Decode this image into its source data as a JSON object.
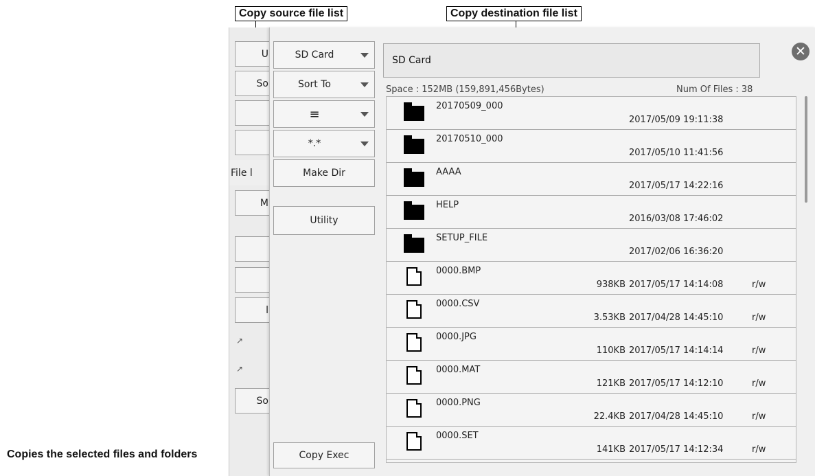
{
  "callouts": {
    "source": "Copy source file list",
    "destination": "Copy destination file list",
    "copy_exec": "Copies the selected files and folders"
  },
  "source_panel": {
    "fragments": [
      "U",
      "So",
      "",
      "",
      "File l",
      "M",
      "",
      "",
      "l",
      "",
      "",
      "So"
    ]
  },
  "sidebar": {
    "drive": "SD Card",
    "sort": "Sort To",
    "view": "≡",
    "filter": "*.*",
    "make_dir": "Make Dir",
    "utility": "Utility",
    "copy_exec": "Copy Exec"
  },
  "path": "SD Card",
  "space_text": "Space : 152MB (159,891,456Bytes)",
  "num_files_text": "Num Of Files : 38",
  "files": [
    {
      "type": "folder",
      "name": "20170509_000",
      "size": "",
      "date": "2017/05/09 19:11:38",
      "attr": ""
    },
    {
      "type": "folder",
      "name": "20170510_000",
      "size": "",
      "date": "2017/05/10 11:41:56",
      "attr": ""
    },
    {
      "type": "folder",
      "name": "AAAA",
      "size": "",
      "date": "2017/05/17 14:22:16",
      "attr": ""
    },
    {
      "type": "folder",
      "name": "HELP",
      "size": "",
      "date": "2016/03/08 17:46:02",
      "attr": ""
    },
    {
      "type": "folder",
      "name": "SETUP_FILE",
      "size": "",
      "date": "2017/02/06 16:36:20",
      "attr": ""
    },
    {
      "type": "file",
      "name": "0000.BMP",
      "size": "938KB",
      "date": "2017/05/17 14:14:08",
      "attr": "r/w"
    },
    {
      "type": "file",
      "name": "0000.CSV",
      "size": "3.53KB",
      "date": "2017/04/28 14:45:10",
      "attr": "r/w"
    },
    {
      "type": "file",
      "name": "0000.JPG",
      "size": "110KB",
      "date": "2017/05/17 14:14:14",
      "attr": "r/w"
    },
    {
      "type": "file",
      "name": "0000.MAT",
      "size": "121KB",
      "date": "2017/05/17 14:12:10",
      "attr": "r/w"
    },
    {
      "type": "file",
      "name": "0000.PNG",
      "size": "22.4KB",
      "date": "2017/04/28 14:45:10",
      "attr": "r/w"
    },
    {
      "type": "file",
      "name": "0000.SET",
      "size": "141KB",
      "date": "2017/05/17 14:12:34",
      "attr": "r/w"
    }
  ]
}
